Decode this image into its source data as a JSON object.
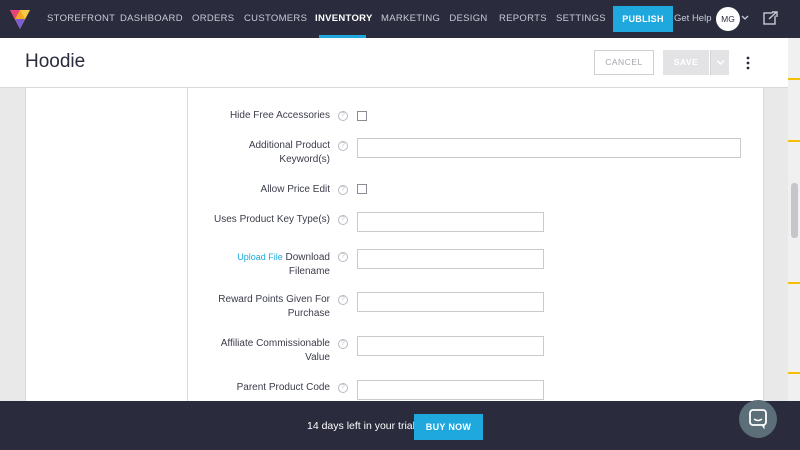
{
  "nav": {
    "items": [
      {
        "label": "STOREFRONT"
      },
      {
        "label": "DASHBOARD"
      },
      {
        "label": "ORDERS"
      },
      {
        "label": "CUSTOMERS"
      },
      {
        "label": "INVENTORY"
      },
      {
        "label": "MARKETING"
      },
      {
        "label": "DESIGN"
      },
      {
        "label": "REPORTS"
      },
      {
        "label": "SETTINGS"
      }
    ],
    "active": "INVENTORY",
    "publish_label": "PUBLISH",
    "help_label": "Get Help",
    "avatar_initials": "MG"
  },
  "header": {
    "title": "Hoodie",
    "cancel_label": "CANCEL",
    "save_label": "SAVE"
  },
  "form": {
    "hide_free_accessories": {
      "label": "Hide Free Accessories",
      "checked": false
    },
    "additional_keywords": {
      "label_line1": "Additional Product",
      "label_line2": "Keyword(s)",
      "value": ""
    },
    "allow_price_edit": {
      "label": "Allow Price Edit",
      "checked": false
    },
    "product_key_types": {
      "label": "Uses Product Key Type(s)",
      "value": ""
    },
    "download_filename": {
      "link_label": "Upload File",
      "label_line1": "Download",
      "label_line2": "Filename",
      "value": ""
    },
    "reward_points": {
      "label_line1": "Reward Points Given For",
      "label_line2": "Purchase",
      "value": ""
    },
    "affiliate_value": {
      "label_line1": "Affiliate Commissionable",
      "label_line2": "Value",
      "value": ""
    },
    "parent_product_code": {
      "label": "Parent Product Code",
      "value": ""
    },
    "help_glyph": "?"
  },
  "trial": {
    "text": "14 days left in your trial",
    "buy_label": "BUY NOW"
  },
  "colors": {
    "nav_bg": "#2a2c3d",
    "accent": "#1fa8dd",
    "scroll_marker": "#f2c200"
  }
}
